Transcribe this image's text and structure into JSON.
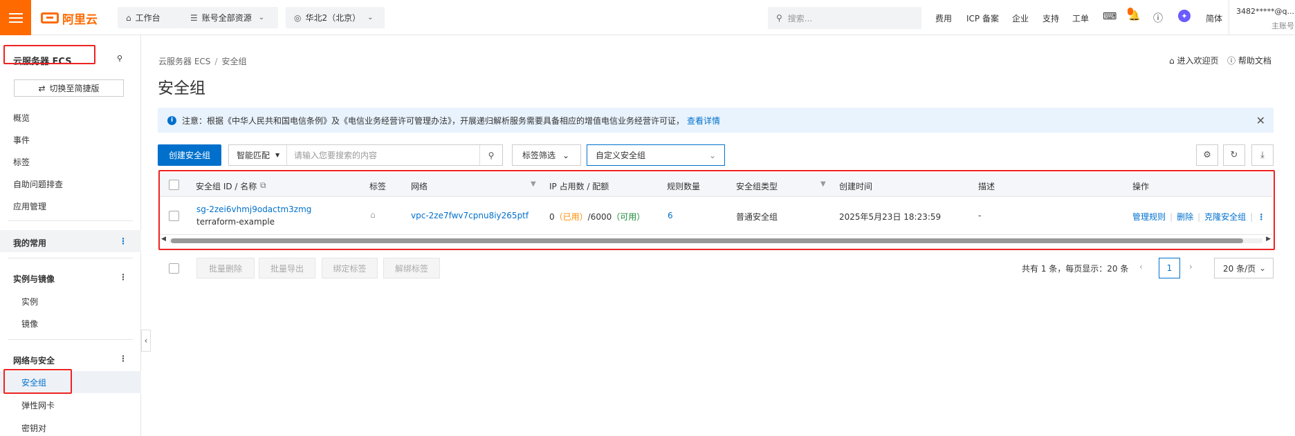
{
  "topbar": {
    "logo_text": "阿里云",
    "workbench": "工作台",
    "account_resources": "账号全部资源",
    "region": "华北2（北京）",
    "search_placeholder": "搜索...",
    "links": [
      "费用",
      "ICP 备案",
      "企业",
      "支持",
      "工单"
    ],
    "notification_badge": "",
    "language": "简体",
    "account_name": "3482*****@q...",
    "account_type": "主账号"
  },
  "sidebar": {
    "title": "云服务器 ECS",
    "switch_label": "切换至简捷版",
    "items": [
      "概览",
      "事件",
      "标签",
      "自助问题排查",
      "应用管理"
    ],
    "favorites_group": "我的常用",
    "instances_group": "实例与镜像",
    "instances_items": [
      "实例",
      "镜像"
    ],
    "network_group": "网络与安全",
    "network_items": [
      "安全组",
      "弹性网卡",
      "密钥对"
    ]
  },
  "breadcrumb": [
    "云服务器 ECS",
    "安全组"
  ],
  "page_title": "安全组",
  "header_links": {
    "welcome": "进入欢迎页",
    "help": "帮助文档"
  },
  "notice": {
    "text": "注意：根据《中华人民共和国电信条例》及《电信业务经营许可管理办法》，开展递归解析服务需要具备相应的增值电信业务经营许可证，",
    "link": "查看详情"
  },
  "toolbar": {
    "create_button": "创建安全组",
    "match_mode": "智能匹配",
    "search_placeholder": "请输入您要搜索的内容",
    "tag_filter": "标签筛选",
    "custom_select": "自定义安全组"
  },
  "table": {
    "columns": [
      "安全组 ID / 名称",
      "标签",
      "网络",
      "IP 占用数 / 配额",
      "规则数量",
      "安全组类型",
      "创建时间",
      "描述",
      "操作"
    ],
    "rows": [
      {
        "id": "sg-2zei6vhmj9odactm3zmg",
        "name": "terraform-example",
        "network": "vpc-2ze7fwv7cpnu8iy265ptf",
        "ip_used": "0",
        "ip_used_label": "（已用）",
        "ip_quota": "/6000",
        "ip_avail_label": "（可用）",
        "rule_count": "6",
        "type": "普通安全组",
        "created": "2025年5月23日 18:23:59",
        "description": "-",
        "actions": [
          "管理规则",
          "删除",
          "克隆安全组"
        ]
      }
    ]
  },
  "bulk_actions": [
    "批量删除",
    "批量导出",
    "绑定标签",
    "解绑标签"
  ],
  "pagination": {
    "summary": "共有 1 条，每页显示：20 条",
    "current_page": "1",
    "page_size": "20 条/页"
  },
  "colors": {
    "brand": "#ff6a00",
    "primary": "#0070cc",
    "highlight_box": "#ee2222"
  }
}
